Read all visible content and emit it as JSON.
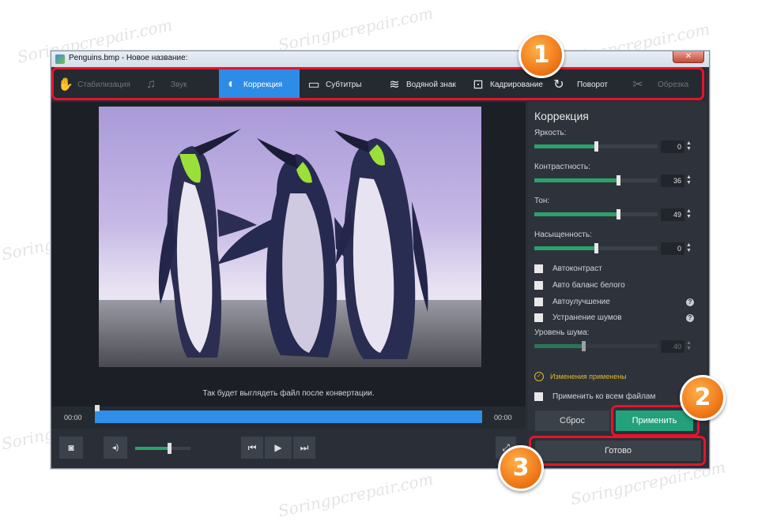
{
  "window": {
    "title": "Penguins.bmp - Новое название:",
    "close": "✕"
  },
  "watermark": "Soringpcrepair.com",
  "toolbar": {
    "items": [
      {
        "label": "Стабилизация",
        "icon": "hand-icon",
        "glyph": "✋"
      },
      {
        "label": "Звук",
        "icon": "music-note-icon",
        "glyph": "♫"
      },
      {
        "label": "Коррекция",
        "icon": "contrast-icon",
        "glyph": "◐"
      },
      {
        "label": "Субтитры",
        "icon": "speech-bubble-icon",
        "glyph": "▭"
      },
      {
        "label": "Водяной знак",
        "icon": "watermark-icon",
        "glyph": "≋"
      },
      {
        "label": "Кадрирование",
        "icon": "crop-icon",
        "glyph": "⊡"
      },
      {
        "label": "Поворот",
        "icon": "rotate-icon",
        "glyph": "↻"
      },
      {
        "label": "Обрезка",
        "icon": "scissors-icon",
        "glyph": "✂"
      }
    ],
    "active_index": 2
  },
  "preview": {
    "caption": "Так будет выглядеть файл после конвертации."
  },
  "timeline": {
    "start": "00:00",
    "end": "00:00"
  },
  "controls": {
    "snapshot_glyph": "◙",
    "volume_glyph": "◂)",
    "prev_glyph": "⏮",
    "play_glyph": "▶",
    "next_glyph": "⏭",
    "fullscreen_glyph": "⤢",
    "volume_level": 0.62
  },
  "panel": {
    "title": "Коррекция",
    "sliders": [
      {
        "label": "Яркость:",
        "value": "0",
        "fraction": 0.5
      },
      {
        "label": "Контрастность:",
        "value": "36",
        "fraction": 0.68
      },
      {
        "label": "Тон:",
        "value": "49",
        "fraction": 0.68
      },
      {
        "label": "Насыщенность:",
        "value": "0",
        "fraction": 0.5
      }
    ],
    "checkboxes": [
      {
        "label": "Автоконтраст",
        "help": false
      },
      {
        "label": "Авто баланс белого",
        "help": false
      },
      {
        "label": "Автоулучшение",
        "help": true
      },
      {
        "label": "Устранение шумов",
        "help": true
      }
    ],
    "noise": {
      "label": "Уровень шума:",
      "value": "40",
      "fraction": 0.4
    },
    "applied_text": "Изменения применены",
    "apply_all": "Применить ко всем файлам",
    "reset": "Сброс",
    "apply": "Применить",
    "done": "Готово"
  },
  "callouts": [
    "1",
    "2",
    "3"
  ],
  "colors": {
    "accent": "#2d8ce6",
    "apply": "#23a17a",
    "callout": "#e8122b",
    "badge": "#f07a1a"
  }
}
